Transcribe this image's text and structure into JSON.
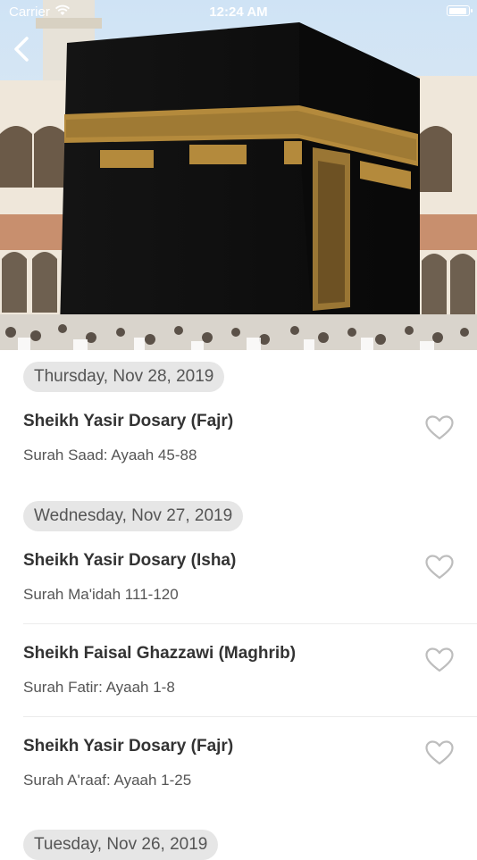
{
  "status_bar": {
    "carrier": "Carrier",
    "time": "12:24 AM"
  },
  "icons": {
    "back": "chevron-left-icon",
    "favorite": "heart-outline-icon",
    "wifi": "wifi-icon",
    "battery": "battery-icon"
  },
  "colors": {
    "accent": "#ffffff",
    "chip_bg": "#e6e6e6",
    "heart": "#bdbdbd",
    "kaaba_gold": "#b48a3c"
  },
  "sections": [
    {
      "date": "Thursday, Nov 28, 2019",
      "items": [
        {
          "title": "Sheikh Yasir Dosary (Fajr)",
          "subtitle": "Surah Saad: Ayaah 45-88"
        }
      ]
    },
    {
      "date": "Wednesday, Nov 27, 2019",
      "items": [
        {
          "title": "Sheikh Yasir Dosary (Isha)",
          "subtitle": "Surah Ma'idah 111-120"
        },
        {
          "title": "Sheikh Faisal Ghazzawi (Maghrib)",
          "subtitle": "Surah Fatir: Ayaah 1-8"
        },
        {
          "title": "Sheikh Yasir Dosary (Fajr)",
          "subtitle": "Surah A'raaf: Ayaah 1-25"
        }
      ]
    },
    {
      "date": "Tuesday, Nov 26, 2019",
      "items": []
    }
  ]
}
